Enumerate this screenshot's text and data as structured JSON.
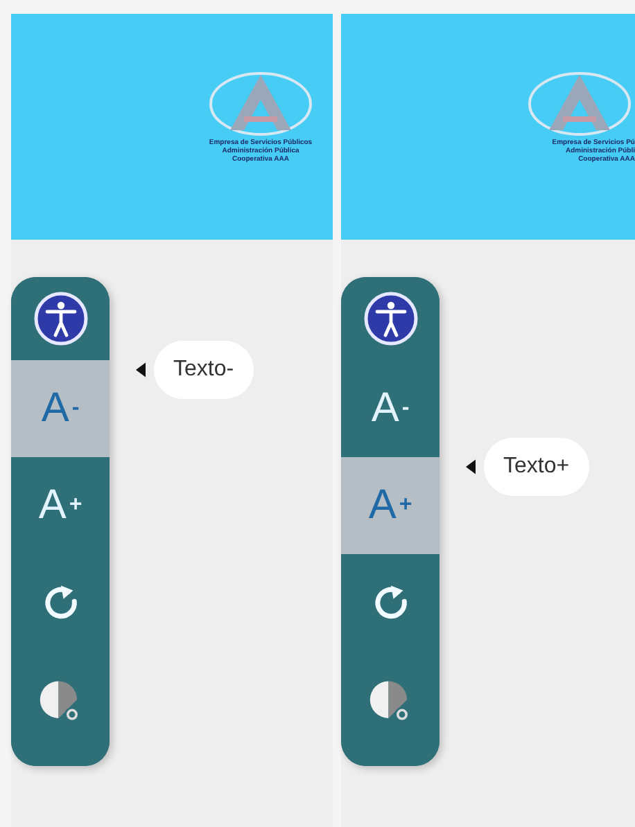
{
  "panels": [
    {
      "logo_lines": [
        "Empresa de Servicios Públicos",
        "Administración Pública",
        "Cooperativa AAA"
      ],
      "toolbar": [
        {
          "kind": "accessibility",
          "selected": false
        },
        {
          "kind": "font",
          "letter": "A",
          "sign": "-",
          "selected": true
        },
        {
          "kind": "font",
          "letter": "A",
          "sign": "+",
          "selected": false
        },
        {
          "kind": "reset",
          "selected": false
        },
        {
          "kind": "contrast",
          "selected": false
        }
      ],
      "tooltip": "Texto-"
    },
    {
      "logo_lines": [
        "Empresa de Servicios Pú",
        "Administración Públi",
        "Cooperativa AAA"
      ],
      "toolbar": [
        {
          "kind": "accessibility",
          "selected": false
        },
        {
          "kind": "font",
          "letter": "A",
          "sign": "-",
          "selected": false
        },
        {
          "kind": "font",
          "letter": "A",
          "sign": "+",
          "selected": true
        },
        {
          "kind": "reset",
          "selected": false
        },
        {
          "kind": "contrast",
          "selected": false
        }
      ],
      "tooltip": "Texto+"
    }
  ]
}
